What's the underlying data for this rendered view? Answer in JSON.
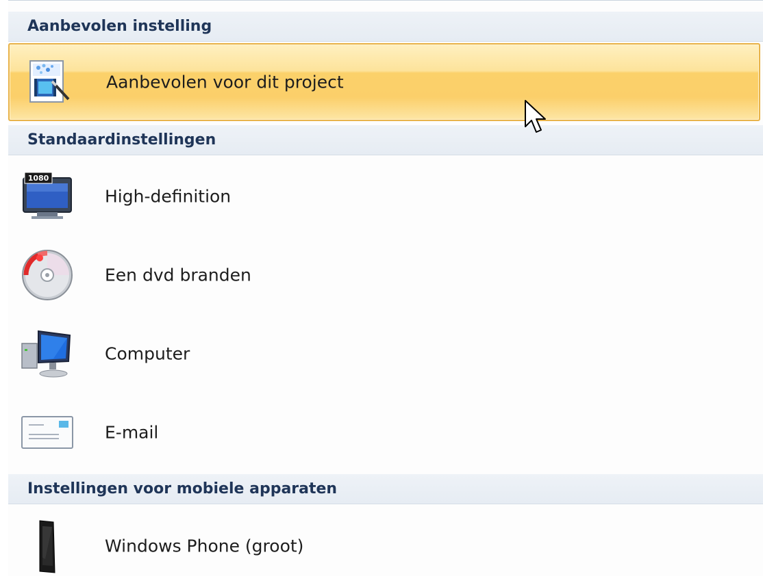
{
  "sections": {
    "recommended": {
      "title": "Aanbevolen instelling",
      "items": [
        {
          "label": "Aanbevolen voor dit project",
          "icon": "recommended-project-icon",
          "selected": true
        }
      ]
    },
    "standard": {
      "title": "Standaardinstellingen",
      "items": [
        {
          "label": "High-definition",
          "icon": "hd-tv-icon",
          "badge": "1080"
        },
        {
          "label": "Een dvd branden",
          "icon": "dvd-burn-icon"
        },
        {
          "label": "Computer",
          "icon": "computer-icon"
        },
        {
          "label": "E-mail",
          "icon": "email-icon"
        }
      ]
    },
    "mobile": {
      "title": "Instellingen voor mobiele apparaten",
      "items": [
        {
          "label": "Windows Phone (groot)",
          "icon": "windows-phone-icon"
        }
      ]
    }
  },
  "colors": {
    "selected_highlight": "#fbd16a",
    "header_text": "#1f3558",
    "header_bg": "#e6ecf3"
  }
}
